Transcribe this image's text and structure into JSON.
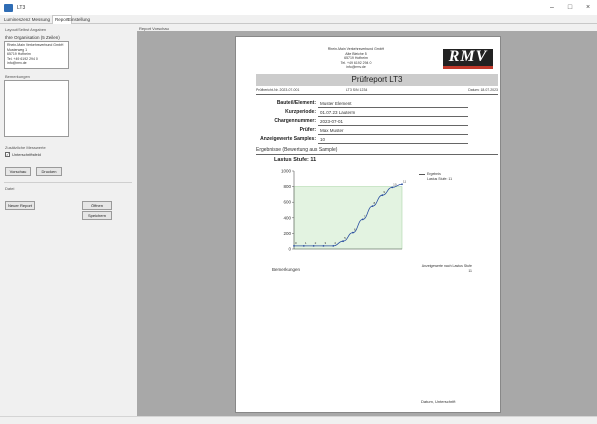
{
  "window": {
    "title": "LT3",
    "minimize": "–",
    "maximize": "□",
    "close": "×"
  },
  "tabs": [
    {
      "label": "Lumineszenz Messung"
    },
    {
      "label": "Report"
    },
    {
      "label": "Einstellung"
    }
  ],
  "left": {
    "section_label": "Layout/Selbst Angaben",
    "org_label": "Ihre Organisation (5 Zeilen)",
    "org_lines": [
      "Rhein-Main Verkehrsverbund GmbH",
      "Musterweg 1",
      "65719 Hofheim",
      "Tel. +49 6192 294 0",
      "info@rmv.de"
    ],
    "remarks_label": "Bemerkungen",
    "checkbox_text_1": "Zusätzliche Messwerte",
    "checkbox_text_2": "Unterschriftsfeld",
    "checkbox_mark": "✓",
    "btn_preview": "Vorschau",
    "btn_print": "Drucken",
    "save_label": "Datei",
    "btn_new": "Neuer Report",
    "btn_open": "Öffnen",
    "btn_save": "Speichern"
  },
  "viewer": {
    "label": "Report Vorschau"
  },
  "report": {
    "address": [
      "Rhein-Main Verkehrsverbund GmbH",
      "Alte Bleiche 5",
      "65719 Hofheim",
      "Tel. +49 6192 294 0",
      "info@rmv.de"
    ],
    "logo": "RMV",
    "banner": "Prüfreport LT3",
    "header_left": "Prüfbericht-Nr. 2023-07-001",
    "header_mid": "LT3 S/N 1234",
    "header_right": "Datum: 18.07.2023",
    "fields": [
      {
        "label": "Bauteil/Element:",
        "value": "Muster Element"
      },
      {
        "label": "Kurzperiode:",
        "value": "01.07.23 Lauterm"
      },
      {
        "label": "Chargennummer:",
        "value": "2023-07-01"
      },
      {
        "label": "Prüfer:",
        "value": "Max Muster"
      },
      {
        "label": "Anzeigewerte Samples:",
        "value": "10"
      }
    ],
    "section_title": "Ergebnisse (Bewertung aus Sample)",
    "chart_title": "Lastus Stufe: 11",
    "legend_1": "Ergebnis",
    "legend_2": "Lastus Stufe: 11",
    "note": "Anzeigewerte nach Lastus Stufe 11",
    "remarks": "Bemerkungen",
    "footer": "Datum, Unterschrift"
  },
  "chart_data": {
    "type": "line",
    "title": "Lastus Stufe: 11",
    "x": [
      0,
      1,
      2,
      3,
      4,
      5,
      6,
      7,
      8,
      9,
      10,
      11
    ],
    "series": [
      {
        "name": "Lastus Stufe: 11",
        "values": [
          40,
          40,
          40,
          40,
          40,
          100,
          210,
          380,
          550,
          690,
          790,
          830
        ]
      }
    ],
    "y_ticks": [
      0,
      200,
      400,
      600,
      800,
      1000
    ],
    "ylim": [
      0,
      1000
    ],
    "xlim": [
      0,
      11
    ],
    "band": [
      0,
      800
    ],
    "colors": {
      "line": "#2a4fa0",
      "band": "#e3f3e1",
      "points": "#2a4fa0"
    }
  }
}
